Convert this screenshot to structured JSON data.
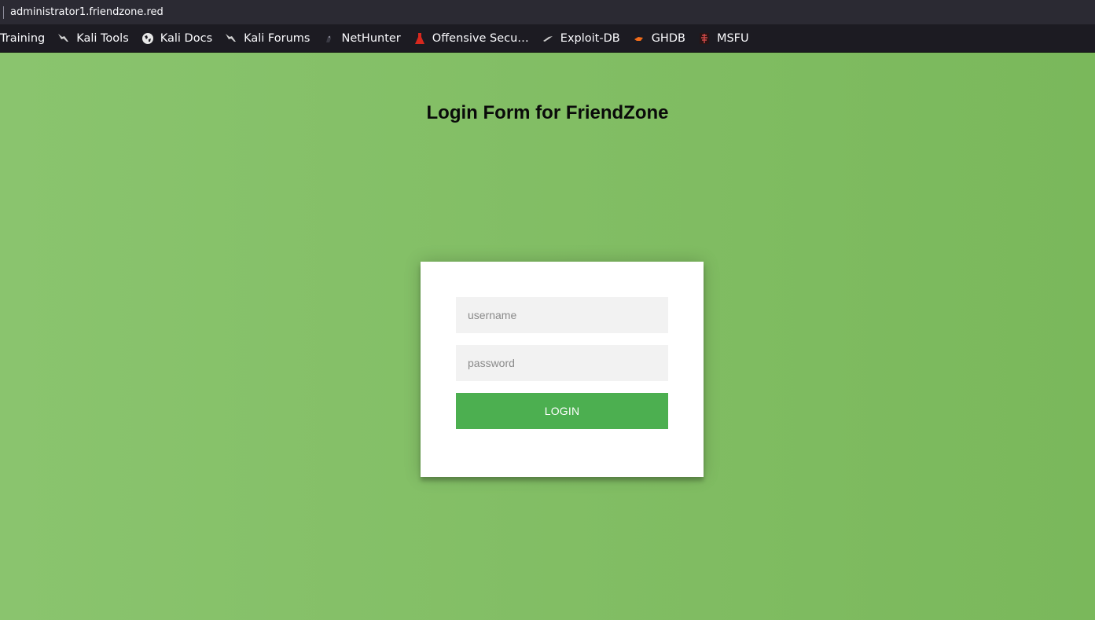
{
  "browser": {
    "url": "administrator1.friendzone.red",
    "bookmarks": [
      {
        "label": "Training",
        "icon": "none"
      },
      {
        "label": "Kali Tools",
        "icon": "kali-dragon-icon"
      },
      {
        "label": "Kali Docs",
        "icon": "globe-icon"
      },
      {
        "label": "Kali Forums",
        "icon": "kali-dragon-icon"
      },
      {
        "label": "NetHunter",
        "icon": "nethunter-icon"
      },
      {
        "label": "Offensive Secu…",
        "icon": "offsec-icon"
      },
      {
        "label": "Exploit-DB",
        "icon": "exploit-db-icon"
      },
      {
        "label": "GHDB",
        "icon": "ghdb-icon"
      },
      {
        "label": "MSFU",
        "icon": "msfu-icon"
      }
    ]
  },
  "page": {
    "title": "Login Form for FriendZone",
    "form": {
      "username_placeholder": "username",
      "username_value": "",
      "password_placeholder": "password",
      "password_value": "",
      "login_label": "LOGIN"
    }
  },
  "colors": {
    "background": "#83be63",
    "button": "#4caf50",
    "input_bg": "#f2f2f2",
    "card": "#ffffff"
  }
}
